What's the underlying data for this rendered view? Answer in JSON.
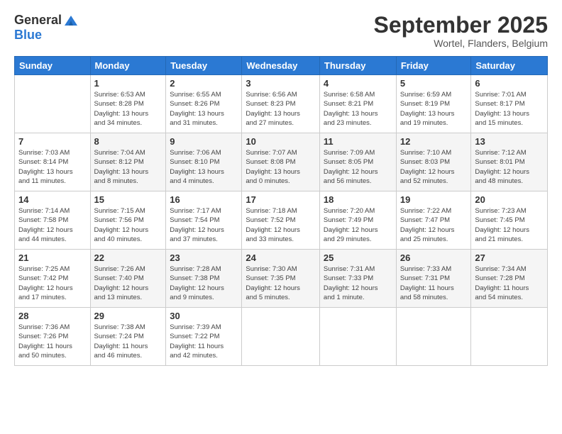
{
  "logo": {
    "general": "General",
    "blue": "Blue"
  },
  "title": {
    "month": "September 2025",
    "location": "Wortel, Flanders, Belgium"
  },
  "headers": [
    "Sunday",
    "Monday",
    "Tuesday",
    "Wednesday",
    "Thursday",
    "Friday",
    "Saturday"
  ],
  "weeks": [
    [
      {
        "day": "",
        "info": ""
      },
      {
        "day": "1",
        "info": "Sunrise: 6:53 AM\nSunset: 8:28 PM\nDaylight: 13 hours\nand 34 minutes."
      },
      {
        "day": "2",
        "info": "Sunrise: 6:55 AM\nSunset: 8:26 PM\nDaylight: 13 hours\nand 31 minutes."
      },
      {
        "day": "3",
        "info": "Sunrise: 6:56 AM\nSunset: 8:23 PM\nDaylight: 13 hours\nand 27 minutes."
      },
      {
        "day": "4",
        "info": "Sunrise: 6:58 AM\nSunset: 8:21 PM\nDaylight: 13 hours\nand 23 minutes."
      },
      {
        "day": "5",
        "info": "Sunrise: 6:59 AM\nSunset: 8:19 PM\nDaylight: 13 hours\nand 19 minutes."
      },
      {
        "day": "6",
        "info": "Sunrise: 7:01 AM\nSunset: 8:17 PM\nDaylight: 13 hours\nand 15 minutes."
      }
    ],
    [
      {
        "day": "7",
        "info": "Sunrise: 7:03 AM\nSunset: 8:14 PM\nDaylight: 13 hours\nand 11 minutes."
      },
      {
        "day": "8",
        "info": "Sunrise: 7:04 AM\nSunset: 8:12 PM\nDaylight: 13 hours\nand 8 minutes."
      },
      {
        "day": "9",
        "info": "Sunrise: 7:06 AM\nSunset: 8:10 PM\nDaylight: 13 hours\nand 4 minutes."
      },
      {
        "day": "10",
        "info": "Sunrise: 7:07 AM\nSunset: 8:08 PM\nDaylight: 13 hours\nand 0 minutes."
      },
      {
        "day": "11",
        "info": "Sunrise: 7:09 AM\nSunset: 8:05 PM\nDaylight: 12 hours\nand 56 minutes."
      },
      {
        "day": "12",
        "info": "Sunrise: 7:10 AM\nSunset: 8:03 PM\nDaylight: 12 hours\nand 52 minutes."
      },
      {
        "day": "13",
        "info": "Sunrise: 7:12 AM\nSunset: 8:01 PM\nDaylight: 12 hours\nand 48 minutes."
      }
    ],
    [
      {
        "day": "14",
        "info": "Sunrise: 7:14 AM\nSunset: 7:58 PM\nDaylight: 12 hours\nand 44 minutes."
      },
      {
        "day": "15",
        "info": "Sunrise: 7:15 AM\nSunset: 7:56 PM\nDaylight: 12 hours\nand 40 minutes."
      },
      {
        "day": "16",
        "info": "Sunrise: 7:17 AM\nSunset: 7:54 PM\nDaylight: 12 hours\nand 37 minutes."
      },
      {
        "day": "17",
        "info": "Sunrise: 7:18 AM\nSunset: 7:52 PM\nDaylight: 12 hours\nand 33 minutes."
      },
      {
        "day": "18",
        "info": "Sunrise: 7:20 AM\nSunset: 7:49 PM\nDaylight: 12 hours\nand 29 minutes."
      },
      {
        "day": "19",
        "info": "Sunrise: 7:22 AM\nSunset: 7:47 PM\nDaylight: 12 hours\nand 25 minutes."
      },
      {
        "day": "20",
        "info": "Sunrise: 7:23 AM\nSunset: 7:45 PM\nDaylight: 12 hours\nand 21 minutes."
      }
    ],
    [
      {
        "day": "21",
        "info": "Sunrise: 7:25 AM\nSunset: 7:42 PM\nDaylight: 12 hours\nand 17 minutes."
      },
      {
        "day": "22",
        "info": "Sunrise: 7:26 AM\nSunset: 7:40 PM\nDaylight: 12 hours\nand 13 minutes."
      },
      {
        "day": "23",
        "info": "Sunrise: 7:28 AM\nSunset: 7:38 PM\nDaylight: 12 hours\nand 9 minutes."
      },
      {
        "day": "24",
        "info": "Sunrise: 7:30 AM\nSunset: 7:35 PM\nDaylight: 12 hours\nand 5 minutes."
      },
      {
        "day": "25",
        "info": "Sunrise: 7:31 AM\nSunset: 7:33 PM\nDaylight: 12 hours\nand 1 minute."
      },
      {
        "day": "26",
        "info": "Sunrise: 7:33 AM\nSunset: 7:31 PM\nDaylight: 11 hours\nand 58 minutes."
      },
      {
        "day": "27",
        "info": "Sunrise: 7:34 AM\nSunset: 7:28 PM\nDaylight: 11 hours\nand 54 minutes."
      }
    ],
    [
      {
        "day": "28",
        "info": "Sunrise: 7:36 AM\nSunset: 7:26 PM\nDaylight: 11 hours\nand 50 minutes."
      },
      {
        "day": "29",
        "info": "Sunrise: 7:38 AM\nSunset: 7:24 PM\nDaylight: 11 hours\nand 46 minutes."
      },
      {
        "day": "30",
        "info": "Sunrise: 7:39 AM\nSunset: 7:22 PM\nDaylight: 11 hours\nand 42 minutes."
      },
      {
        "day": "",
        "info": ""
      },
      {
        "day": "",
        "info": ""
      },
      {
        "day": "",
        "info": ""
      },
      {
        "day": "",
        "info": ""
      }
    ]
  ]
}
